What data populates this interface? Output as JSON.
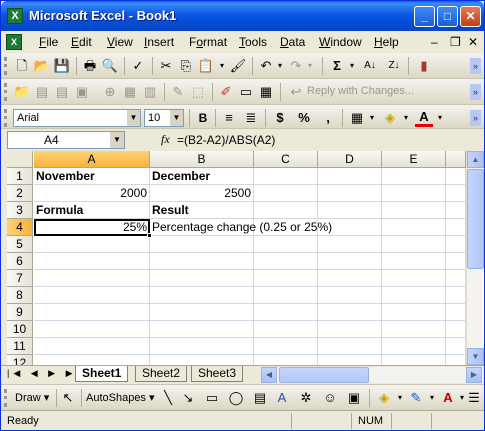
{
  "title": "Microsoft Excel - Book1",
  "menu": [
    "File",
    "Edit",
    "View",
    "Insert",
    "Format",
    "Tools",
    "Data",
    "Window",
    "Help"
  ],
  "menu_ul": [
    "F",
    "E",
    "V",
    "I",
    "o",
    "T",
    "D",
    "W",
    "H"
  ],
  "window_controls": "_ ₋ ✕",
  "reviewing": {
    "reply_label": "Reply with Changes..."
  },
  "formatting": {
    "font": "Arial",
    "size": "10",
    "bold": "B",
    "currency": "$",
    "percent": "%",
    "comma": ","
  },
  "formula_bar": {
    "name_box": "A4",
    "fx": "fx",
    "formula": "=(B2-A2)/ABS(A2)"
  },
  "columns": [
    "A",
    "B",
    "C",
    "D",
    "E"
  ],
  "rows": [
    "1",
    "2",
    "3",
    "4",
    "5",
    "6",
    "7",
    "8",
    "9",
    "10",
    "11",
    "12"
  ],
  "cells": {
    "A1": "November",
    "B1": "December",
    "A2": "2000",
    "B2": "2500",
    "A3": "Formula",
    "B3": "Result",
    "A4": "25%",
    "B4": "Percentage change (0.25 or 25%)"
  },
  "active_cell": "A4",
  "sheets": [
    "Sheet1",
    "Sheet2",
    "Sheet3"
  ],
  "active_sheet": "Sheet1",
  "draw_toolbar": {
    "draw": "Draw ▾",
    "autoshapes": "AutoShapes ▾"
  },
  "status": {
    "left": "Ready",
    "num": "NUM"
  }
}
